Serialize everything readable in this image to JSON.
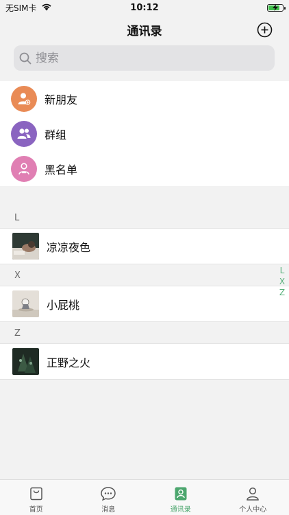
{
  "status_bar": {
    "carrier": "无SIM卡",
    "time": "10:12",
    "battery_charging": true,
    "battery_level": 0.85
  },
  "nav": {
    "title": "通讯录"
  },
  "search": {
    "placeholder": "搜索"
  },
  "top_items": [
    {
      "label": "新朋友",
      "icon": "new-friend-icon",
      "color": "#e98b56"
    },
    {
      "label": "群组",
      "icon": "group-icon",
      "color": "#8a64c0"
    },
    {
      "label": "黑名单",
      "icon": "blacklist-icon",
      "color": "#e07fb3"
    }
  ],
  "sections": [
    {
      "letter": "L",
      "contacts": [
        {
          "name": "凉凉夜色",
          "avatar": "bedroom-photo"
        }
      ]
    },
    {
      "letter": "X",
      "contacts": [
        {
          "name": "小屁桃",
          "avatar": "figurine-photo"
        }
      ]
    },
    {
      "letter": "Z",
      "contacts": [
        {
          "name": "正野之火",
          "avatar": "pine-photo"
        }
      ]
    }
  ],
  "index_letters": [
    "L",
    "X",
    "Z"
  ],
  "tabs": [
    {
      "label": "首页",
      "icon": "shopping-bag-icon",
      "active": false
    },
    {
      "label": "消息",
      "icon": "chat-bubble-icon",
      "active": false
    },
    {
      "label": "通讯录",
      "icon": "contacts-book-icon",
      "active": true
    },
    {
      "label": "个人中心",
      "icon": "person-icon",
      "active": false
    }
  ],
  "colors": {
    "accent": "#4ca66e",
    "background": "#f2f2f2",
    "battery": "#3fbf4a"
  }
}
